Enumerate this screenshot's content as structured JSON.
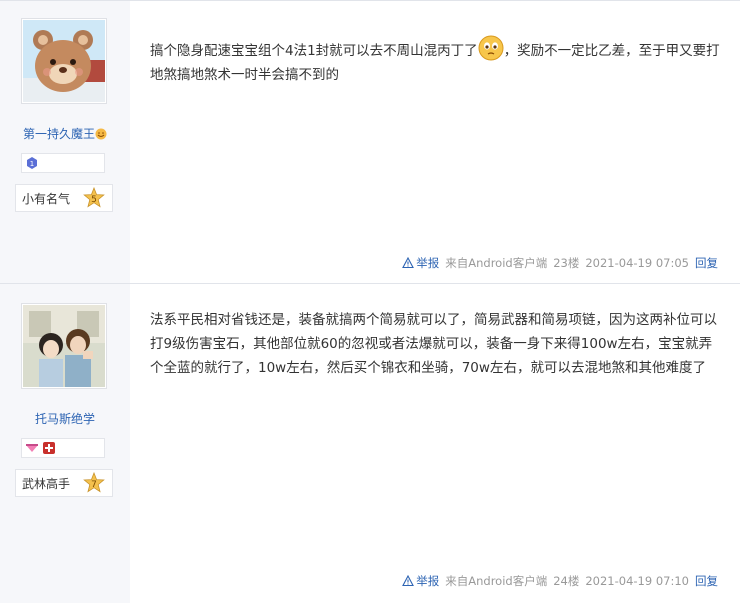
{
  "posts": [
    {
      "username": "第一持久魔王",
      "rank_label": "小有名气",
      "level": "5",
      "content_before": "搞个隐身配速宝宝组个4法1封就可以去不周山混丙丁了",
      "content_after": "，奖励不一定比乙差，至于甲又要打地煞搞地煞术一时半会搞不到的",
      "report": "举报",
      "source": "来自Android客户端",
      "floor": "23楼",
      "time": "2021-04-19 07:05",
      "reply": "回复"
    },
    {
      "username": "托马斯绝学",
      "rank_label": "武林高手",
      "level": "7",
      "content": "法系平民相对省钱还是，装备就搞两个简易就可以了，简易武器和简易项链，因为这两补位可以打9级伤害宝石，其他部位就60的忽视或者法爆就可以，装备一身下来得100w左右，宝宝就弄个全蓝的就行了，10w左右，然后买个锦衣和坐骑，70w左右，就可以去混地煞和其他难度了",
      "report": "举报",
      "source": "来自Android客户端",
      "floor": "24楼",
      "time": "2021-04-19 07:10",
      "reply": "回复"
    }
  ],
  "colors": {
    "link": "#2d64b3",
    "side_bg": "#f6f7fa",
    "meta": "#999999"
  },
  "icons": [
    "bear-avatar",
    "anime-avatar",
    "warning-icon",
    "smiley-emoji",
    "badge-icon",
    "level-star-icon"
  ]
}
